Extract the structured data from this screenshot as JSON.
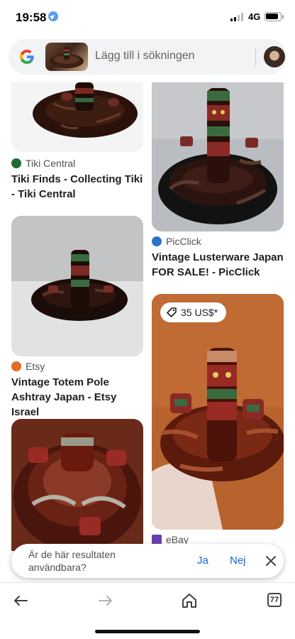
{
  "status_bar": {
    "time": "19:58",
    "network": "4G"
  },
  "search": {
    "placeholder": "Lägg till i sökningen"
  },
  "results": [
    {
      "source": "Tiki Central",
      "title": "Tiki Finds - Collecting Tiki - Tiki Central"
    },
    {
      "source": "PicClick",
      "title": "Vintage Lusterware Japan FOR SALE! - PicClick"
    },
    {
      "source": "Etsy",
      "title": "Vintage Totem Pole Ashtray Japan - Etsy Israel"
    },
    {
      "source": "eBay",
      "price": "35 US$*"
    }
  ],
  "feedback": {
    "question": "Är de här resultaten användbara?",
    "yes": "Ja",
    "no": "Nej"
  },
  "bottom_nav": {
    "tab_count": "77"
  },
  "icons": [
    "location-icon",
    "signal-icon",
    "battery-icon",
    "google-logo-icon",
    "tag-icon",
    "close-icon",
    "back-arrow-icon",
    "forward-arrow-icon",
    "home-icon",
    "tabs-icon"
  ],
  "colors": {
    "link_blue": "#1a62c9",
    "search_bg": "#f1f3f4"
  }
}
